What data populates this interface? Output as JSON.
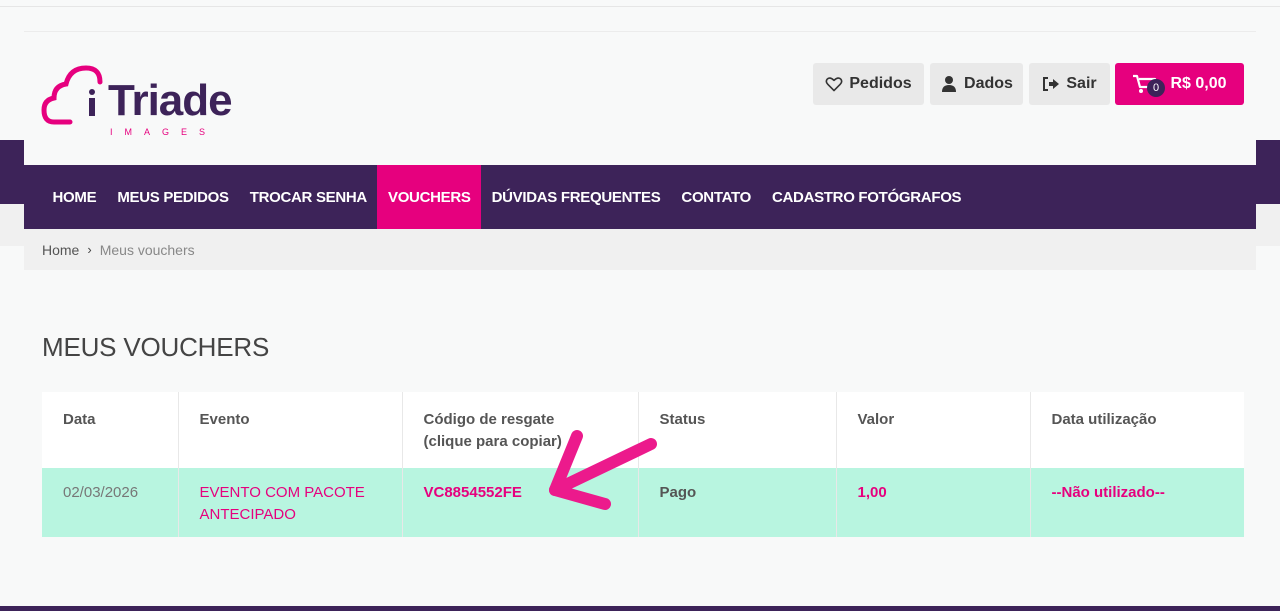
{
  "brand": {
    "name": "Triade",
    "subtitle": "IMAGES",
    "colors": {
      "primary": "#3d2359",
      "accent": "#e6007e",
      "row_highlight": "#b8f5e0"
    }
  },
  "header": {
    "buttons": [
      {
        "label": "Pedidos",
        "icon": "heart-icon"
      },
      {
        "label": "Dados",
        "icon": "user-icon"
      },
      {
        "label": "Sair",
        "icon": "sign-out-icon"
      }
    ],
    "cart": {
      "count": "0",
      "total": "R$ 0,00",
      "icon": "cart-icon"
    }
  },
  "nav": {
    "items": [
      "HOME",
      "MEUS PEDIDOS",
      "TROCAR SENHA",
      "VOUCHERS",
      "DÚVIDAS FREQUENTES",
      "CONTATO",
      "CADASTRO FOTÓGRAFOS"
    ],
    "active": "VOUCHERS"
  },
  "breadcrumb": {
    "home": "Home",
    "separator": "›",
    "current": "Meus vouchers"
  },
  "page": {
    "title": "MEUS VOUCHERS"
  },
  "table": {
    "headers": [
      "Data",
      "Evento",
      "Código de resgate",
      "(clique para copiar)",
      "Status",
      "Valor",
      "Data utilização"
    ],
    "rows": [
      {
        "data": "02/03/2026",
        "evento_l1": "EVENTO COM PACOTE",
        "evento_l2": "ANTECIPADO",
        "codigo": "VC8854552FE",
        "status": "Pago",
        "valor": "1,00",
        "data_utilizacao": "--Não utilizado--"
      }
    ]
  }
}
